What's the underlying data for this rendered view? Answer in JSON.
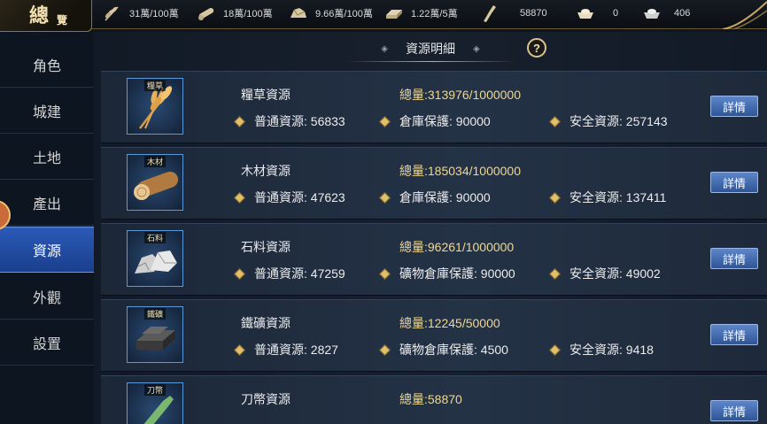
{
  "header": {
    "logo_big": "總",
    "logo_small": "覽",
    "resources": [
      {
        "icon": "wheat-icon",
        "value": "31萬/100萬"
      },
      {
        "icon": "wood-icon",
        "value": "18萬/100萬"
      },
      {
        "icon": "stone-icon",
        "value": "9.66萬/100萬"
      },
      {
        "icon": "iron-icon",
        "value": "1.22萬/5萬"
      },
      {
        "icon": "token-icon",
        "value": "58870"
      },
      {
        "icon": "gold-ingot-icon",
        "value": "0"
      },
      {
        "icon": "silver-ingot-icon",
        "value": "406"
      }
    ]
  },
  "sidebar": {
    "items": [
      {
        "label": "角色"
      },
      {
        "label": "城建"
      },
      {
        "label": "土地"
      },
      {
        "label": "產出"
      },
      {
        "label": "資源",
        "active": true
      },
      {
        "label": "外觀"
      },
      {
        "label": "設置"
      }
    ]
  },
  "panel": {
    "title": "資源明細",
    "help": "?",
    "detail_label": "詳情",
    "rows": [
      {
        "tag": "糧草",
        "name": "糧草資源",
        "total": "總量:313976/1000000",
        "stat1": "普通資源: 56833",
        "stat2": "倉庫保護: 90000",
        "stat3": "安全資源: 257143"
      },
      {
        "tag": "木材",
        "name": "木材資源",
        "total": "總量:185034/1000000",
        "stat1": "普通資源: 47623",
        "stat2": "倉庫保護: 90000",
        "stat3": "安全資源: 137411"
      },
      {
        "tag": "石料",
        "name": "石料資源",
        "total": "總量:96261/1000000",
        "stat1": "普通資源: 47259",
        "stat2": "礦物倉庫保護: 90000",
        "stat3": "安全資源: 49002"
      },
      {
        "tag": "鐵礦",
        "name": "鐵礦資源",
        "total": "總量:12245/50000",
        "stat1": "普通資源: 2827",
        "stat2": "礦物倉庫保護: 4500",
        "stat3": "安全資源: 9418"
      },
      {
        "tag": "刀幣",
        "name": "刀幣資源",
        "total": "總量:58870",
        "stat1": "",
        "stat2": "",
        "stat3": ""
      }
    ]
  },
  "colors": {
    "accent_gold": "#f0d890",
    "active_tab": "#2b5ab8",
    "detail_button": "#3f68ac"
  }
}
